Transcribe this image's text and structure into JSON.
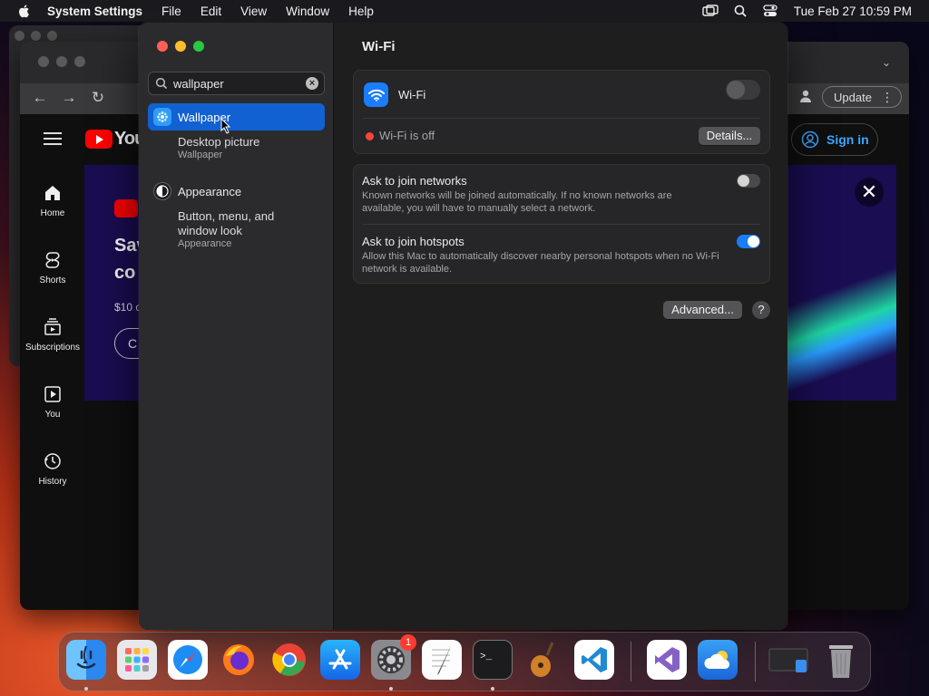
{
  "menubar": {
    "app_name": "System Settings",
    "menus": [
      "File",
      "Edit",
      "View",
      "Window",
      "Help"
    ],
    "clock": "Tue Feb 27  10:59 PM"
  },
  "background_browser": {
    "nav_items": [
      {
        "label": "Home",
        "icon": "home-icon"
      },
      {
        "label": "Shorts",
        "icon": "shorts-icon"
      },
      {
        "label": "Subscriptions",
        "icon": "subscriptions-icon"
      },
      {
        "label": "You",
        "icon": "you-icon"
      },
      {
        "label": "History",
        "icon": "history-icon"
      }
    ],
    "logo_text": "You",
    "update_label": "Update",
    "signin_label": "Sign in",
    "banner_text_1": "Sav",
    "banner_text_2": "co",
    "banner_text_3": "$10 c",
    "banner_button": "C"
  },
  "settings": {
    "search": {
      "value": "wallpaper",
      "placeholder": "Search"
    },
    "results": [
      {
        "label": "Wallpaper",
        "icon": "wallpaper-icon",
        "selected": true,
        "subs": [
          {
            "title": "Desktop picture",
            "sub": "Wallpaper"
          }
        ]
      },
      {
        "label": "Appearance",
        "icon": "appearance-icon",
        "selected": false,
        "subs": [
          {
            "title": "Button, menu, and window look",
            "sub": "Appearance"
          }
        ]
      }
    ],
    "page_title": "Wi-Fi",
    "wifi": {
      "label": "Wi-Fi",
      "enabled": false,
      "status": "Wi-Fi is off",
      "details_button": "Details..."
    },
    "ask_networks": {
      "label": "Ask to join networks",
      "description": "Known networks will be joined automatically. If no known networks are available, you will have to manually select a network.",
      "enabled": false
    },
    "ask_hotspots": {
      "label": "Ask to join hotspots",
      "description": "Allow this Mac to automatically discover nearby personal hotspots when no Wi-Fi network is available.",
      "enabled": true
    },
    "advanced_button": "Advanced...",
    "help_button": "?"
  },
  "dock": {
    "apps": [
      "Finder",
      "Launchpad",
      "Safari",
      "Firefox",
      "Chrome",
      "App Store",
      "System Settings",
      "TextEdit",
      "Terminal",
      "GarageBand",
      "Visual Studio Code",
      "Visual Studio",
      "Weather",
      "Downloads",
      "Trash"
    ],
    "settings_badge": "1"
  },
  "colors": {
    "accent": "#1161d2",
    "toggle_on": "#1a7dfb",
    "status_off": "#ff453a"
  }
}
